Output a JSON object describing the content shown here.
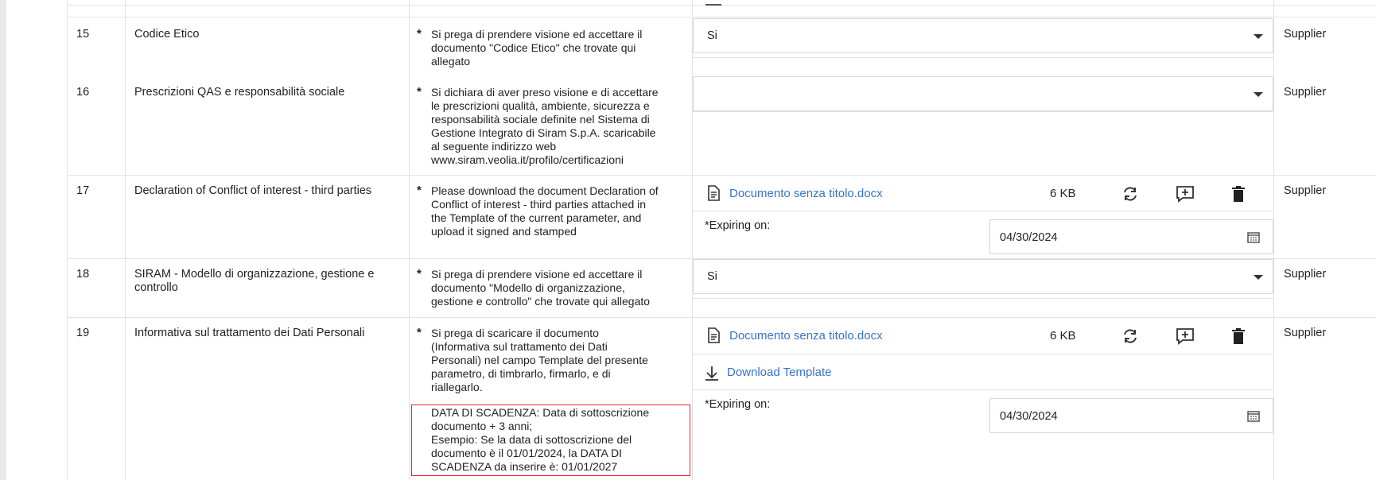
{
  "rows": [
    {
      "num": "15",
      "name": "Codice Etico",
      "desc_lines": [
        "Si prega di prendere visione ed accettare il",
        "documento \"Codice Etico\" che trovate qui",
        "allegato"
      ],
      "select_value": "Si",
      "assignee": "Supplier"
    },
    {
      "num": "16",
      "name": "Prescrizioni QAS e responsabilità sociale",
      "desc_lines": [
        "Si dichiara di aver preso visione e di accettare",
        "le prescrizioni qualità, ambiente, sicurezza e",
        "responsabilità sociale definite nel Sistema di",
        "Gestione Integrato di Siram S.p.A. scaricabile",
        "al seguente indirizzo web",
        "www.siram.veolia.it/profilo/certificazioni"
      ],
      "select_value": "",
      "assignee": "Supplier"
    },
    {
      "num": "17",
      "name": "Declaration of Conflict of interest - third parties",
      "desc_lines": [
        "Please download the document Declaration of",
        "Conflict of interest - third parties attached in",
        "the Template of the current parameter, and",
        "upload it signed and stamped"
      ],
      "file_name": "Documento senza titolo.docx",
      "file_size": "6 KB",
      "expiring_label": "Expiring on:",
      "expiring_date": "04/30/2024",
      "assignee": "Supplier"
    },
    {
      "num": "18",
      "name_lines": [
        "SIRAM - Modello di organizzazione, gestione e",
        "controllo"
      ],
      "desc_lines": [
        "Si prega di prendere visione ed accettare il",
        "documento \"Modello di organizzazione,",
        "gestione e controllo\" che trovate qui allegato"
      ],
      "select_value": "Si",
      "assignee": "Supplier"
    },
    {
      "num": "19",
      "name": "Informativa sul trattamento dei Dati Personali",
      "desc_lines": [
        "Si prega di scaricare il documento",
        "(Informativa sul trattamento dei Dati",
        "Personali) nel campo Template del presente",
        "parametro, di timbrarlo, firmarlo, e di",
        "riallegarlo."
      ],
      "note_lines": [
        "DATA DI SCADENZA: Data di sottoscrizione",
        "documento + 3 anni;",
        "Esempio: Se la data di sottoscrizione del",
        "documento è il 01/01/2024, la DATA DI",
        "SCADENZA da inserire è: 01/01/2027"
      ],
      "file_name": "Documento senza titolo.docx",
      "file_size": "6 KB",
      "download_label": "Download Template",
      "expiring_label": "Expiring on:",
      "expiring_date": "04/30/2024",
      "assignee": "Supplier"
    }
  ],
  "required_marker": "*"
}
